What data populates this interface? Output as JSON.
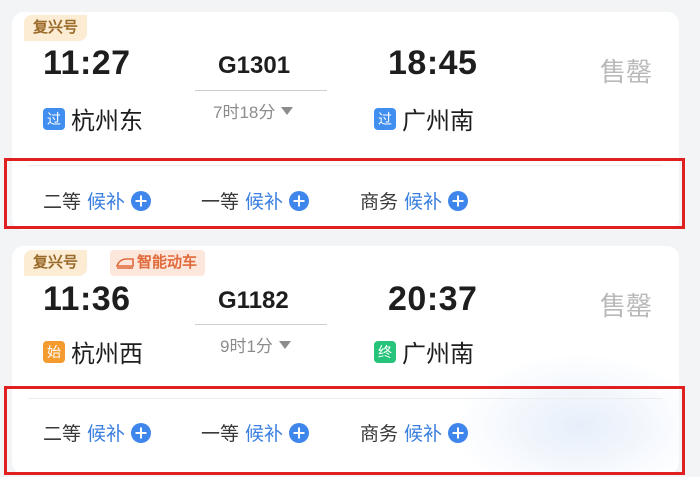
{
  "trains": [
    {
      "type_tag": "复兴号",
      "depart_time": "11:27",
      "train_no": "G1301",
      "duration": "7时18分",
      "arrive_time": "18:45",
      "status": "售罄",
      "from_badge": "过",
      "from_station": "杭州东",
      "to_badge": "过",
      "to_station": "广州南",
      "seats": [
        {
          "class": "二等",
          "action": "候补"
        },
        {
          "class": "一等",
          "action": "候补"
        },
        {
          "class": "商务",
          "action": "候补"
        }
      ]
    },
    {
      "type_tag": "复兴号",
      "extra_tag": "智能动车",
      "depart_time": "11:36",
      "train_no": "G1182",
      "duration": "9时1分",
      "arrive_time": "20:37",
      "status": "售罄",
      "from_badge": "始",
      "from_station": "杭州西",
      "to_badge": "终",
      "to_station": "广州南",
      "seats": [
        {
          "class": "二等",
          "action": "候补"
        },
        {
          "class": "一等",
          "action": "候补"
        },
        {
          "class": "商务",
          "action": "候补"
        }
      ]
    }
  ],
  "colors": {
    "accent_blue": "#3f86ec",
    "highlight_red": "#e02020",
    "tag_gold": "#9a6a2a",
    "badge_orange": "#f39b2f",
    "badge_green": "#26c37a"
  }
}
